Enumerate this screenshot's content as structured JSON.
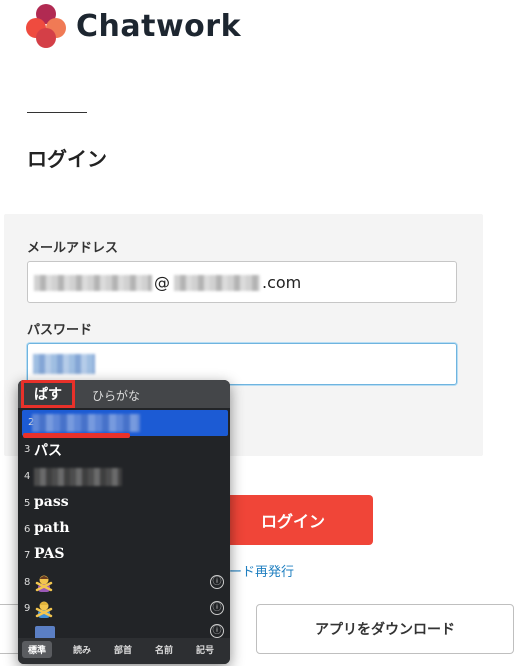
{
  "brand": {
    "name": "Chatwork",
    "colors": [
      "#ef4b3f",
      "#b12a52",
      "#d43f47",
      "#f07a55"
    ]
  },
  "page": {
    "title": "ログイン"
  },
  "form": {
    "email_label": "メールアドレス",
    "email_value": "@",
    "email_suffix": ".com",
    "password_label": "パスワード",
    "login_button": "ログイン",
    "reissue_link": "ード再発行"
  },
  "download_button": "アプリをダウンロード",
  "ime": {
    "composition": "ぱす",
    "mode_label": "ひらがな",
    "candidates": [
      {
        "num": "2",
        "text": ""
      },
      {
        "num": "3",
        "text": "パス"
      },
      {
        "num": "4",
        "text": ""
      },
      {
        "num": "5",
        "text": "pass"
      },
      {
        "num": "6",
        "text": "path"
      },
      {
        "num": "7",
        "text": "PAS"
      },
      {
        "num": "8",
        "text": "",
        "icon": "person-no-gesture-emoji",
        "info": "ⓘ"
      },
      {
        "num": "9",
        "text": "",
        "icon": "person-no-gesture-emoji",
        "info": "ⓘ"
      },
      {
        "num": "",
        "text": "",
        "icon": "ng-button-emoji",
        "info": "ⓘ"
      }
    ],
    "tabs": [
      "標準",
      "読み",
      "部首",
      "名前",
      "記号"
    ],
    "active_tab": "標準"
  }
}
